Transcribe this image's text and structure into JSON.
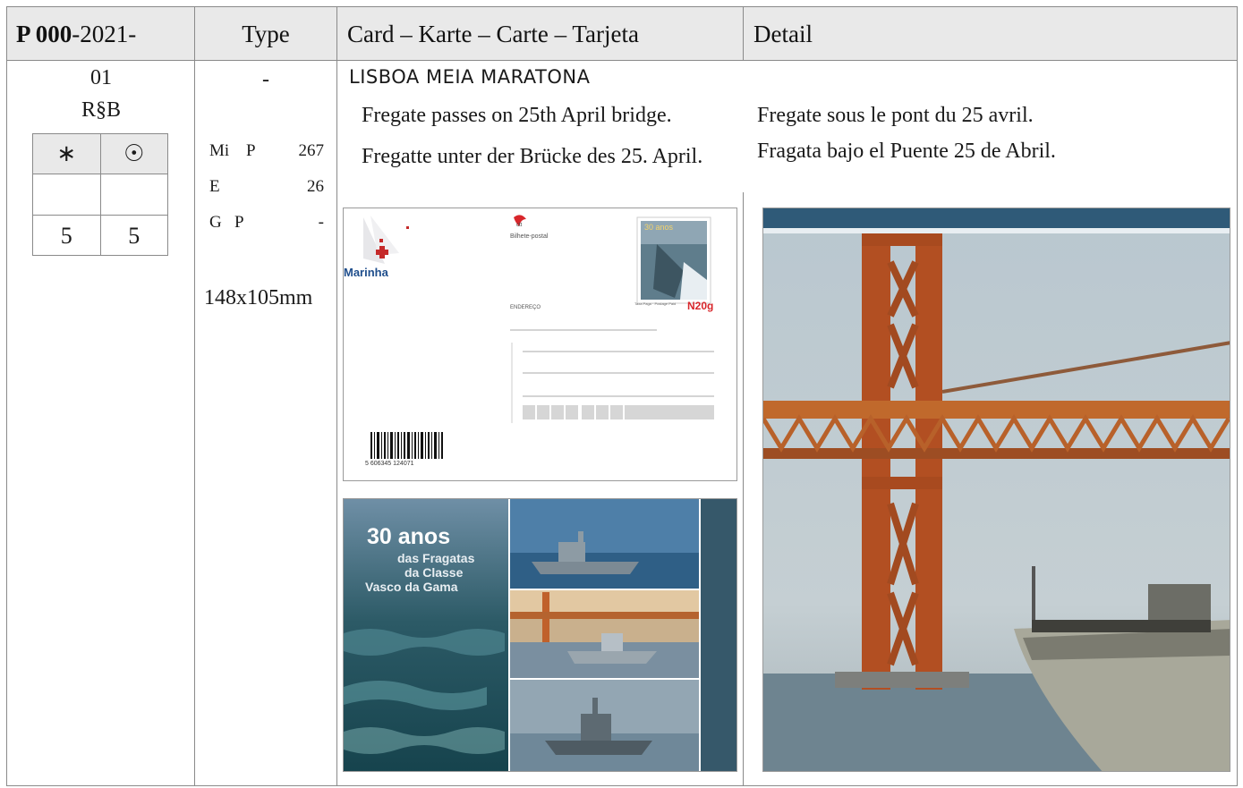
{
  "header": {
    "catalog_prefix": "P 000",
    "catalog_suffix": "-2021-",
    "type": "Type",
    "card": "Card – Karte – Carte – Tarjeta",
    "detail": "Detail"
  },
  "entry": {
    "number": "01",
    "code": "R§B",
    "rating_table": {
      "headers": [
        "∗",
        "☉"
      ],
      "rows": [
        [
          "",
          ""
        ],
        [
          "5",
          "5"
        ]
      ]
    }
  },
  "type_column": {
    "type_value": "-",
    "catalogs": [
      {
        "label": "Mi",
        "sub": "P",
        "value": "267"
      },
      {
        "label": "E",
        "sub": "",
        "value": "26"
      },
      {
        "label": "G",
        "sub": "P",
        "value": "-"
      }
    ],
    "dimensions": "148x105mm"
  },
  "card": {
    "title": "LISBOA MEIA MARATONA",
    "descriptions": {
      "en": "Fregate passes on 25th April bridge.",
      "de": "Fregatte unter der Brücke des 25. April.",
      "fr": "Fregate sous le pont du 25 avril.",
      "es": "Fragata bajo el Puente 25 de Abril."
    }
  },
  "postcard_front": {
    "brand": "Marinha",
    "postal_title": "Bilhete-postal",
    "address_label": "ENDEREÇO",
    "stamp_text": "30 anos",
    "postage": "N20g",
    "postage_note": "Taxa Paga · Postage Paid",
    "barcode_text": "5 606345 124071",
    "ctt_logo": "ctt",
    "colors": {
      "postage_red": "#d8262b",
      "brand_blue": "#1f4e8c"
    }
  },
  "postcard_picture": {
    "headline": "30 anos",
    "line1": "das Fragatas",
    "line2": "da Classe",
    "line3": "Vasco da Gama"
  }
}
